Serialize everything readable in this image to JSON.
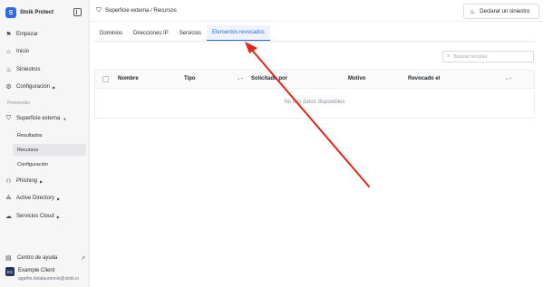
{
  "app": {
    "name": "Stoik Protect",
    "logo_letter": "S"
  },
  "sidebar": {
    "items": [
      {
        "label": "Empezar",
        "icon": "flag-icon"
      },
      {
        "label": "Inicio",
        "icon": "home-icon"
      },
      {
        "label": "Siniestros",
        "icon": "fire-icon"
      },
      {
        "label": "Configuración",
        "icon": "gear-icon"
      }
    ],
    "section_label": "Prevención",
    "surface": {
      "label": "Superficie externa",
      "sub_items": [
        {
          "label": "Resultados"
        },
        {
          "label": "Recursos"
        },
        {
          "label": "Configuración"
        }
      ]
    },
    "more": [
      {
        "label": "Phishing"
      },
      {
        "label": "Active Directory"
      },
      {
        "label": "Servicios Cloud"
      }
    ],
    "help_label": "Centro de ayuda",
    "user": {
      "initials": "EX",
      "name": "Example Client",
      "email": "agathe.delalaurencie@stoik.io"
    }
  },
  "header": {
    "breadcrumb": "Superficie externa / Recursos",
    "declare_button": "Declarar un siniestro"
  },
  "tabs": [
    {
      "label": "Dominios"
    },
    {
      "label": "Direcciones IP"
    },
    {
      "label": "Servicios"
    },
    {
      "label": "Elementos revocados"
    }
  ],
  "search": {
    "placeholder": "Buscar recurso"
  },
  "table": {
    "columns": [
      "Nombre",
      "Tipo",
      "Solicitado por",
      "Motivo",
      "Revocado el"
    ],
    "empty_text": "No hay datos disponibles"
  },
  "colors": {
    "accent": "#2c6be0",
    "annotation_arrow": "#e8231a"
  }
}
